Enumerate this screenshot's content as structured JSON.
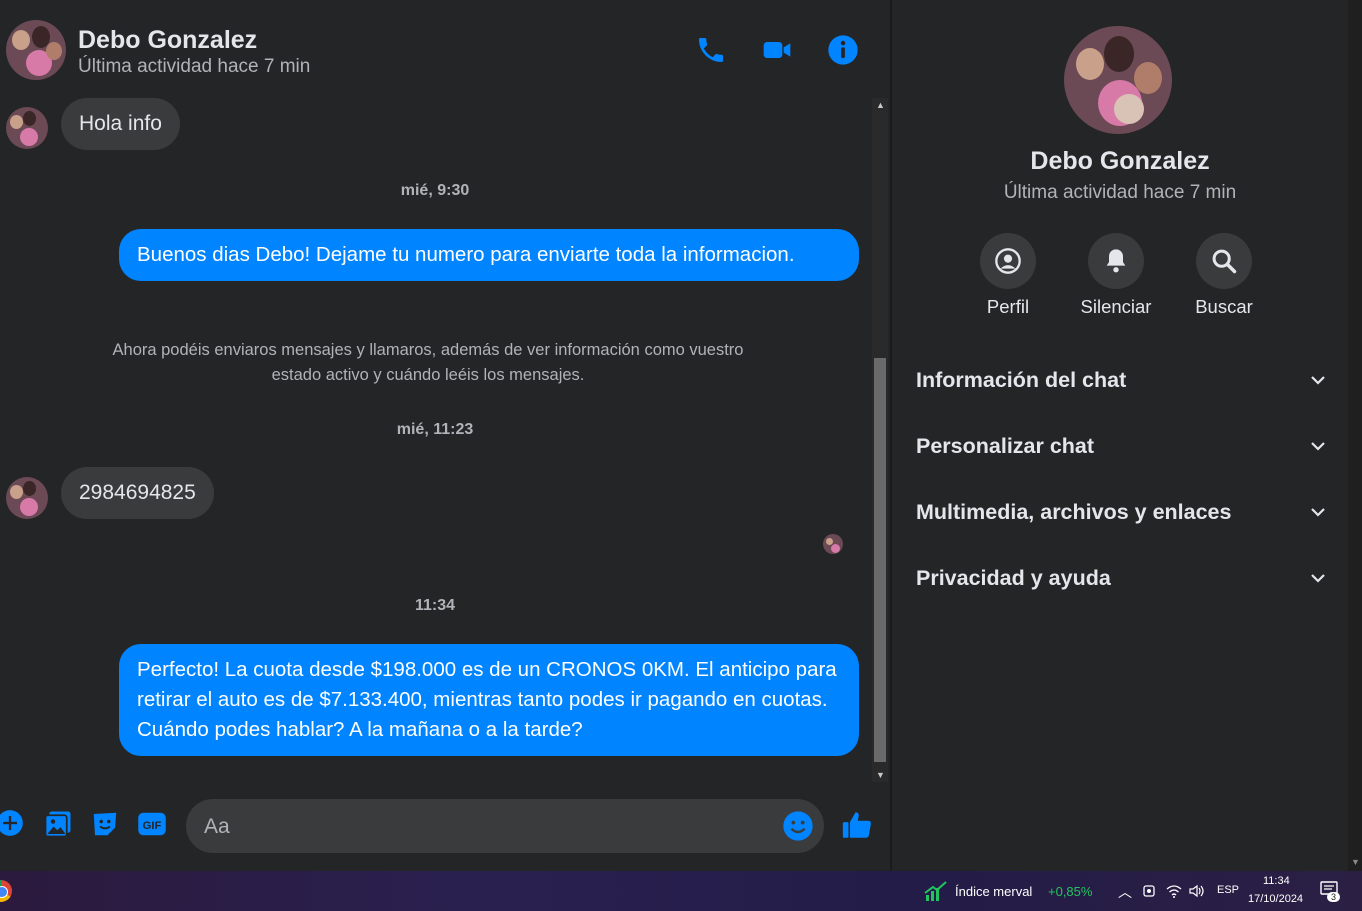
{
  "contact": {
    "name": "Debo Gonzalez",
    "status": "Última actividad hace 7 min"
  },
  "header_actions": {
    "call_icon": "phone-icon",
    "video_icon": "video-icon",
    "info_icon": "info-icon"
  },
  "messages": {
    "msg1": "Hola info",
    "time1": "mié, 9:30",
    "msg2": "Buenos dias Debo! Dejame tu numero para enviarte toda la informacion.",
    "notice": "Ahora podéis enviaros mensajes y llamaros, además de ver información como vuestro estado activo y cuándo leéis los mensajes.",
    "time2": "mié, 11:23",
    "msg3": "2984694825",
    "time3": "11:34",
    "msg4": "Perfecto! La cuota desde $198.000 es de un CRONOS 0KM. El anticipo para retirar el auto es de $7.133.400, mientras tanto podes ir pagando en cuotas. Cuándo podes hablar? A la mañana o a la tarde?"
  },
  "composer": {
    "placeholder": "Aa"
  },
  "side": {
    "actions": {
      "profile": "Perfil",
      "mute": "Silenciar",
      "search": "Buscar"
    },
    "sections": {
      "chat_info": "Información del chat",
      "customize": "Personalizar chat",
      "media": "Multimedia, archivos y enlaces",
      "privacy": "Privacidad y ayuda"
    }
  },
  "taskbar": {
    "widget_label": "Índice merval",
    "widget_value": "+0,85%",
    "language": "ESP",
    "time": "11:34",
    "date": "17/10/2024",
    "notification_count": "3"
  },
  "colors": {
    "accent": "#0084ff",
    "bubble_in": "#3a3b3c",
    "bg": "#242526",
    "positive": "#21c55d"
  }
}
